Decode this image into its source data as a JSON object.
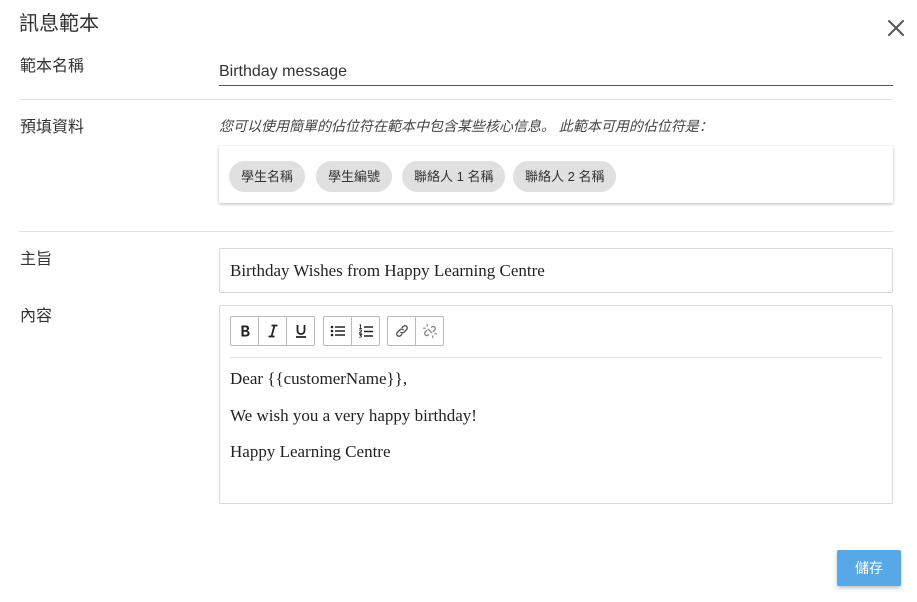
{
  "dialog": {
    "title": "訊息範本",
    "close_icon": "close-icon"
  },
  "template_name": {
    "label": "範本名稱",
    "value": "Birthday message"
  },
  "prefill": {
    "label": "預填資料",
    "hint": "您可以使用簡單的佔位符在範本中包含某些核心信息。 此範本可用的佔位符是：",
    "chips": [
      "學生名稱",
      "學生編號",
      "聯絡人 1 名稱",
      "聯絡人 2 名稱"
    ]
  },
  "subject": {
    "label": "主旨",
    "value": "Birthday Wishes from Happy Learning Centre"
  },
  "content": {
    "label": "內容",
    "toolbar": {
      "bold_icon": "bold-icon",
      "italic_icon": "italic-icon",
      "underline_icon": "underline-icon",
      "bullet_list_icon": "bullet-list-icon",
      "numbered_list_icon": "numbered-list-icon",
      "link_icon": "link-icon",
      "unlink_icon": "unlink-icon"
    },
    "lines": [
      "Dear {{customerName}},",
      "We wish you a very happy birthday!",
      "Happy Learning Centre"
    ]
  },
  "actions": {
    "save_label": "儲存"
  },
  "colors": {
    "primary_button": "#56a9e6",
    "chip_background": "#e0e0e0",
    "divider": "#e2e2e2"
  }
}
